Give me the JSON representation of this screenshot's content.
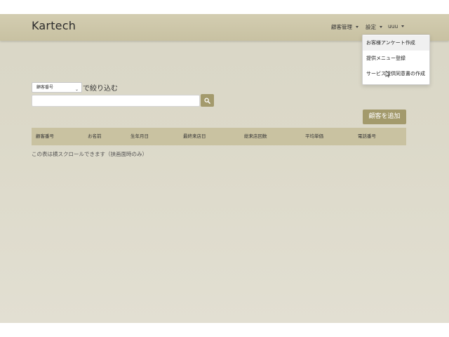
{
  "navbar": {
    "brand": "Kartech",
    "menu_customer": "顧客管理",
    "menu_settings": "設定",
    "menu_user": "uuu"
  },
  "dropdown": {
    "items": [
      {
        "label": "お客様アンケート作成"
      },
      {
        "label": "提供メニュー登録"
      },
      {
        "label": "サービス提供同意書の作成"
      }
    ]
  },
  "filter": {
    "select_value": "顧客番号",
    "label": "で絞り込む",
    "search_value": ""
  },
  "actions": {
    "add_customer": "顧客を追加"
  },
  "table": {
    "columns": [
      "顧客番号",
      "お名前",
      "生年月日",
      "最終来店日",
      "総来店回数",
      "平均単価",
      "電話番号"
    ]
  },
  "note": "この表は横スクロールできます（挟画面時のみ）",
  "colors": {
    "accent": "#a39a6c",
    "navbar": "#cdc7aa",
    "background": "#dcd9c9",
    "table_header": "#c9c2a1"
  }
}
